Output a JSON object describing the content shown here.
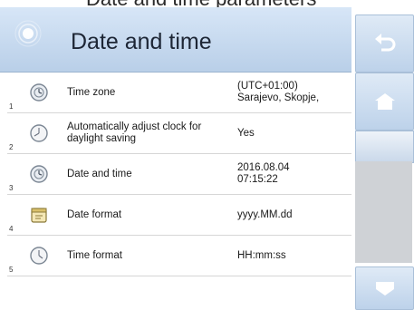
{
  "header": {
    "title": "Date and time"
  },
  "top_clipped_text": "Date and time parameters",
  "rows": [
    {
      "index": "1",
      "label": "Time zone",
      "value": "(UTC+01:00)\nSarajevo, Skopje,",
      "icon": "globe-clock-icon"
    },
    {
      "index": "2",
      "label": "Automatically adjust clock for daylight saving",
      "value": "Yes",
      "icon": "clock-icon"
    },
    {
      "index": "3",
      "label": "Date and time",
      "value": "2016.08.04\n07:15:22",
      "icon": "globe-clock-icon"
    },
    {
      "index": "4",
      "label": "Date format",
      "value": "yyyy.MM.dd",
      "icon": "calendar-icon"
    },
    {
      "index": "5",
      "label": "Time format",
      "value": "HH:mm:ss",
      "icon": "clock-icon"
    }
  ],
  "sidebar": {
    "buttons": [
      "back-button",
      "home-button",
      "scroll-down-button"
    ]
  },
  "colors": {
    "header_bg": "#c8dbf0",
    "accent": "#9bb3cf"
  }
}
